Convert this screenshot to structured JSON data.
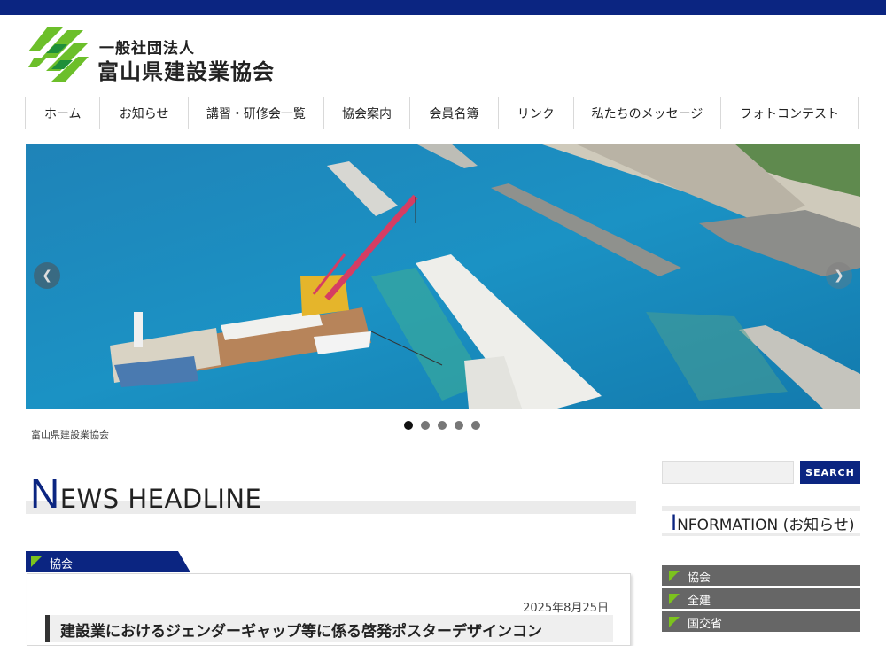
{
  "header": {
    "org_small": "一般社団法人",
    "org_name": "富山県建設業協会"
  },
  "nav": {
    "items": [
      {
        "label": "ホーム",
        "name": "nav-item-home",
        "w": 84
      },
      {
        "label": "お知らせ",
        "name": "nav-item-news",
        "w": 99
      },
      {
        "label": "講習・研修会一覧",
        "name": "nav-item-seminars",
        "w": 153
      },
      {
        "label": "協会案内",
        "name": "nav-item-about",
        "w": 97
      },
      {
        "label": "会員名簿",
        "name": "nav-item-members",
        "w": 99
      },
      {
        "label": "リンク",
        "name": "nav-item-links",
        "w": 85
      },
      {
        "label": "私たちのメッセージ",
        "name": "nav-item-message",
        "w": 166
      },
      {
        "label": "フォトコンテスト",
        "name": "nav-item-photo-contest",
        "w": 155
      }
    ]
  },
  "slider": {
    "caption": "富山県建設業協会",
    "prev_icon": "chevron-left-icon",
    "next_icon": "chevron-right-icon",
    "dot_count": 5,
    "active_dot": 0
  },
  "news": {
    "heading_cap": "N",
    "heading_rest": "EWS HEADLINE",
    "category": "協会",
    "date": "2025年8月25日",
    "title": "建設業におけるジェンダーギャップ等に係る啓発ポスターデザインコン"
  },
  "search": {
    "button_label": "SEARCH",
    "placeholder": ""
  },
  "sidebar": {
    "heading_cap": "I",
    "heading_rest": "NFORMATION (お知らせ)",
    "items": [
      {
        "label": "協会"
      },
      {
        "label": "全建"
      },
      {
        "label": "国交省"
      }
    ]
  },
  "colors": {
    "brand_navy": "#0b2581",
    "accent_green": "#7cc31d",
    "sidebar_gray": "#666666"
  }
}
